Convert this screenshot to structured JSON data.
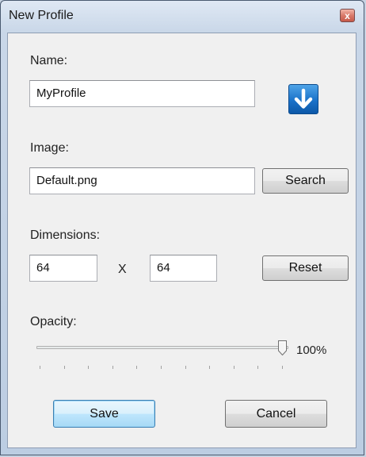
{
  "window": {
    "title": "New Profile",
    "close_glyph": "x"
  },
  "name": {
    "label": "Name:",
    "value": "MyProfile",
    "action_icon": "download-arrow-icon"
  },
  "image": {
    "label": "Image:",
    "value": "Default.png",
    "search_label": "Search"
  },
  "dimensions": {
    "label": "Dimensions:",
    "width": "64",
    "separator": "X",
    "height": "64",
    "reset_label": "Reset"
  },
  "opacity": {
    "label": "Opacity:",
    "value": 100,
    "value_text": "100%"
  },
  "footer": {
    "save_label": "Save",
    "cancel_label": "Cancel"
  },
  "colors": {
    "accent_blue": "#1b72c9",
    "default_button_border": "#3c7fb1",
    "close_button_red": "#c65a4a"
  }
}
